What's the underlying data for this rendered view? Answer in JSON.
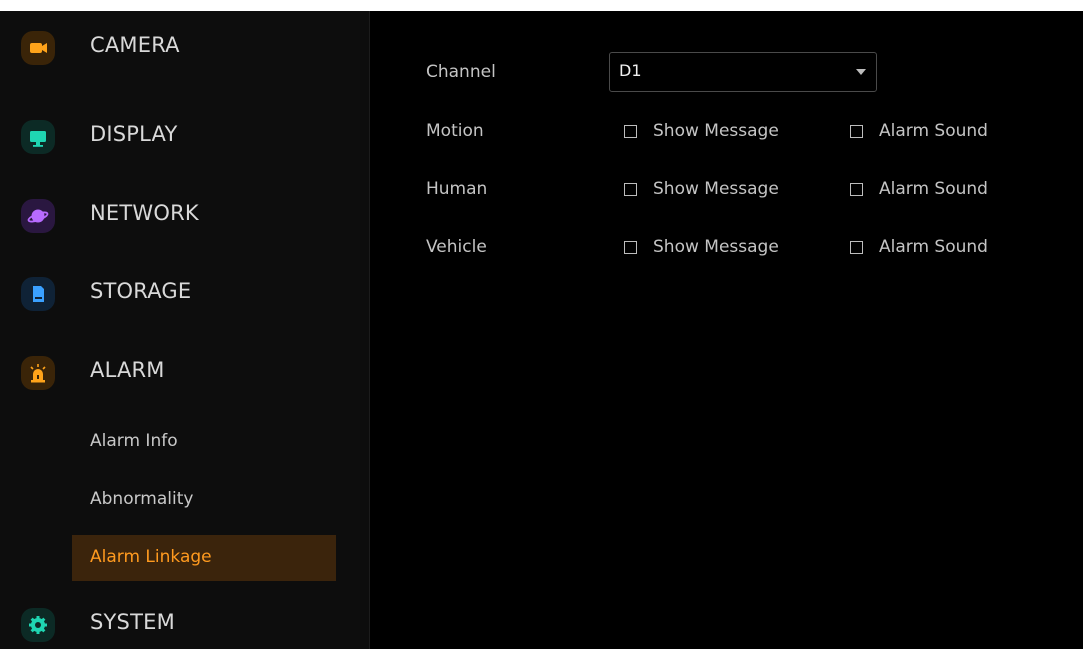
{
  "sidebar": {
    "items": [
      {
        "label": "CAMERA",
        "icon": "camera-icon",
        "icon_bg": "#3a2408",
        "icon_color": "#ffa31a"
      },
      {
        "label": "DISPLAY",
        "icon": "monitor-icon",
        "icon_bg": "#0c2a25",
        "icon_color": "#1fd6b2"
      },
      {
        "label": "NETWORK",
        "icon": "planet-icon",
        "icon_bg": "#2a1740",
        "icon_color": "#b86bff"
      },
      {
        "label": "STORAGE",
        "icon": "sd-card-icon",
        "icon_bg": "#0f2236",
        "icon_color": "#3aa0ff"
      },
      {
        "label": "ALARM",
        "icon": "alarm-light-icon",
        "icon_bg": "#3a2408",
        "icon_color": "#ffa31a"
      },
      {
        "label": "SYSTEM",
        "icon": "gear-icon",
        "icon_bg": "#0c2a25",
        "icon_color": "#1fd6b2"
      }
    ],
    "alarm_sub": [
      {
        "label": "Alarm Info",
        "active": false
      },
      {
        "label": "Abnormality",
        "active": false
      },
      {
        "label": "Alarm Linkage",
        "active": true
      }
    ]
  },
  "main": {
    "channel_label": "Channel",
    "channel_value": "D1",
    "rows": [
      {
        "label": "Motion",
        "show_message": "Show Message",
        "alarm_sound": "Alarm Sound"
      },
      {
        "label": "Human",
        "show_message": "Show Message",
        "alarm_sound": "Alarm Sound"
      },
      {
        "label": "Vehicle",
        "show_message": "Show Message",
        "alarm_sound": "Alarm Sound"
      }
    ]
  },
  "colors": {
    "accent": "#ff9a1f",
    "active_bg": "#3b240c"
  }
}
